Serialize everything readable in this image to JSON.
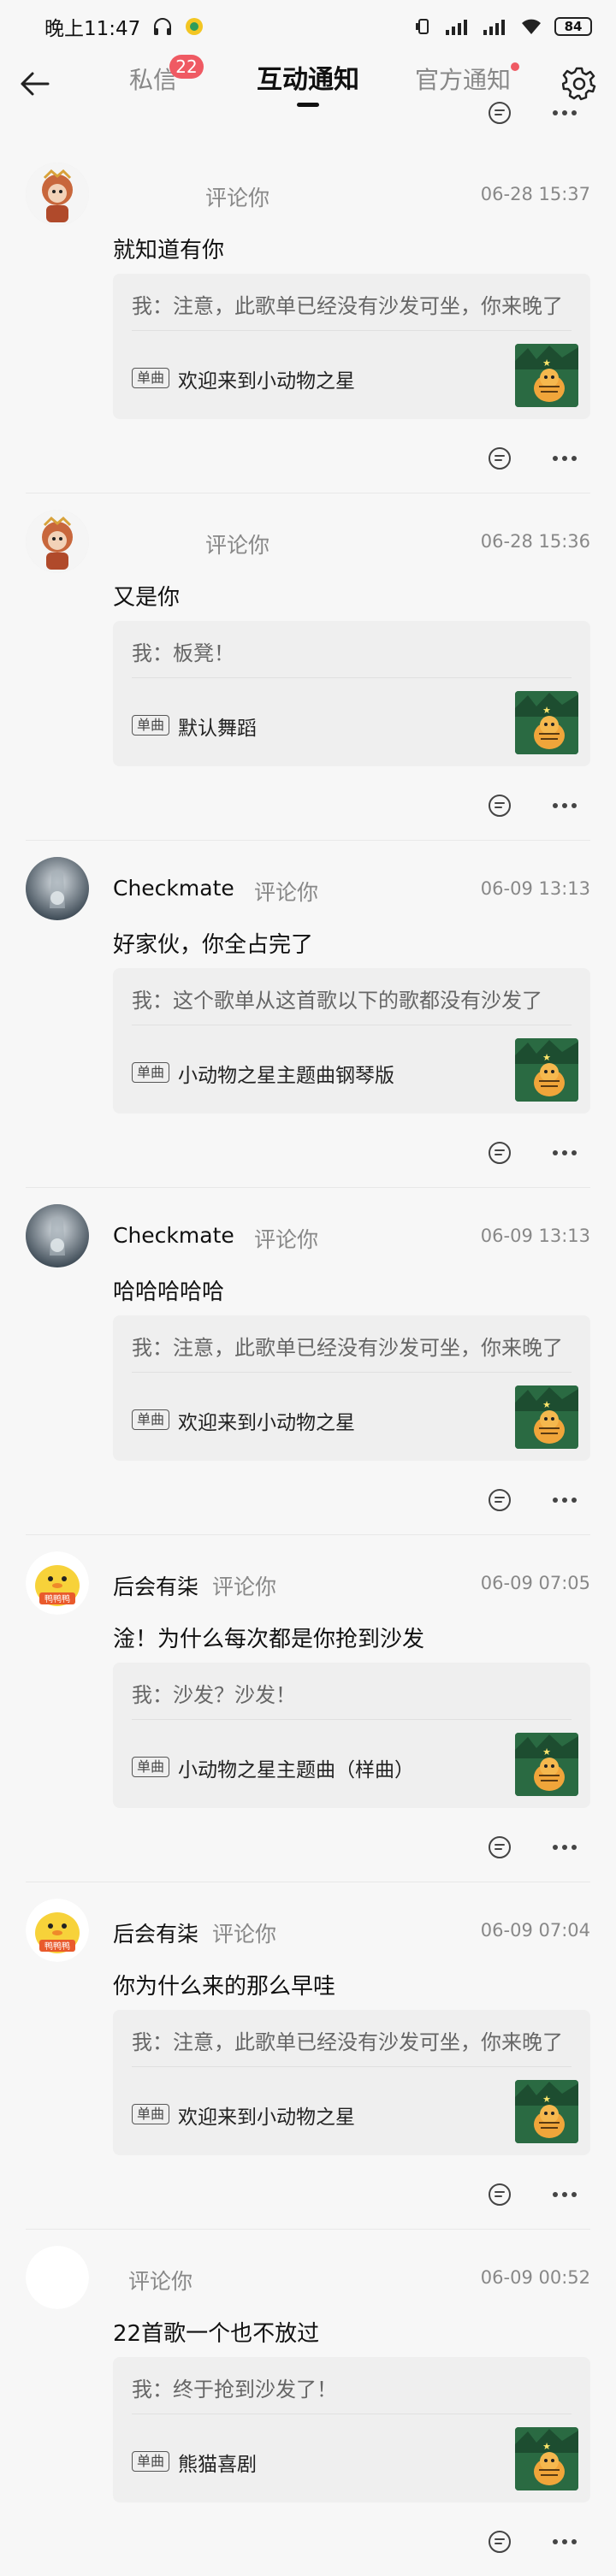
{
  "status": {
    "time": "晚上11:47",
    "battery": "84"
  },
  "nav": {
    "tabs": [
      "私信",
      "互动通知",
      "官方通知"
    ],
    "dm_badge": "22"
  },
  "items": [
    {
      "user": "",
      "action": "评论你",
      "time": "06-28 15:37",
      "content": "就知道有你",
      "quote": "我：注意，此歌单已经没有沙发可坐，你来晚了",
      "tag": "单曲",
      "song": "欢迎来到小动物之星"
    },
    {
      "user": "",
      "action": "评论你",
      "time": "06-28 15:36",
      "content": "又是你",
      "quote": "我：板凳！",
      "tag": "单曲",
      "song": "默认舞蹈"
    },
    {
      "user": "Checkmate",
      "action": "评论你",
      "time": "06-09 13:13",
      "content": "好家伙，你全占完了",
      "quote": "我：这个歌单从这首歌以下的歌都没有沙发了",
      "tag": "单曲",
      "song": "小动物之星主题曲钢琴版"
    },
    {
      "user": "Checkmate",
      "action": "评论你",
      "time": "06-09 13:13",
      "content": "哈哈哈哈哈",
      "quote": "我：注意，此歌单已经没有沙发可坐，你来晚了",
      "tag": "单曲",
      "song": "欢迎来到小动物之星"
    },
    {
      "user": "后会有柒",
      "action": "评论你",
      "time": "06-09 07:05",
      "content": "淦！为什么每次都是你抢到沙发",
      "quote": "我：沙发？沙发！",
      "tag": "单曲",
      "song": "小动物之星主题曲（样曲）"
    },
    {
      "user": "后会有柒",
      "action": "评论你",
      "time": "06-09 07:04",
      "content": "你为什么来的那么早哇",
      "quote": "我：注意，此歌单已经没有沙发可坐，你来晚了",
      "tag": "单曲",
      "song": "欢迎来到小动物之星"
    },
    {
      "user": "",
      "action": "评论你",
      "time": "06-09 00:52",
      "content": "22首歌一个也不放过",
      "quote": "我：终于抢到沙发了！",
      "tag": "单曲",
      "song": "熊猫喜剧"
    }
  ],
  "avatar_texts": {
    "duck": "鸭鸭鸭"
  }
}
